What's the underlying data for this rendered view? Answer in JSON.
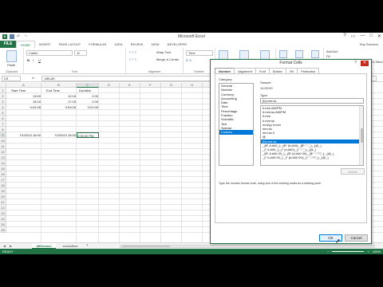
{
  "window": {
    "title": "Microsoft Excel",
    "ctrls": [
      "?",
      "▭",
      "—",
      "□",
      "✕"
    ]
  },
  "ribbon": {
    "file_tab": "FILE",
    "tabs": [
      "HOME",
      "INSERT",
      "PAGE LAYOUT",
      "FORMULAS",
      "DATA",
      "REVIEW",
      "VIEW",
      "DEVELOPER"
    ],
    "active_tab": "HOME",
    "user": "Ray Romano",
    "font_name": "Calibri",
    "font_size": "11",
    "wrap_text": "Wrap Text",
    "merge_center": "Merge & Center",
    "number_format": "Time",
    "paste_label": "Paste",
    "bold": "B",
    "italic": "I",
    "underline": "U",
    "cond_format": "Conditional Formatting",
    "format_table": "Format as Table",
    "cell_styles": "Cell Styles",
    "insert": "Insert",
    "delete": "Delete",
    "format": "Format",
    "autosum": "AutoSum",
    "fill": "Fill",
    "clear": "Clear",
    "sort_filter": "Sort & Filter",
    "find_select": "Find & Select",
    "groups": {
      "clipboard": "Clipboard",
      "font": "Font",
      "alignment": "Alignment",
      "number": "Number",
      "styles": "Styles",
      "cells": "Cells",
      "editing": "Editing"
    }
  },
  "formula_bar": {
    "name_box": "C9",
    "fx": "fx",
    "formula": "=B9-A9"
  },
  "grid": {
    "columns": [
      "A",
      "B",
      "C",
      "D",
      "E",
      "F",
      "G",
      "H",
      "I",
      "J",
      "K",
      "L",
      "M",
      "N",
      "O"
    ],
    "rows": [
      "1",
      "2",
      "3",
      "4",
      "5",
      "6",
      "7",
      "8",
      "9",
      "10",
      "11",
      "12",
      "13",
      "14",
      "15",
      "16",
      "17",
      "18",
      "19",
      "20",
      "21",
      "22",
      "23",
      "24",
      "25",
      "26"
    ],
    "cells": {
      "A1": "Start Time",
      "B1": "End Time",
      "C1": "Duration",
      "A2": "13:00",
      "B2": "12:18",
      "C2": "2.00",
      "A3": "15:15",
      "B3": "17:15",
      "C3": "2.00",
      "A4": "0:02:28",
      "B4": "0:03:26",
      "C4": "0:01:00",
      "A9": "7/1/2013 16:00",
      "B9": "7/2/2013 16:00",
      "C9": "2:00:00 PM"
    }
  },
  "sheets": {
    "tabs": [
      "difference",
      "cumulative"
    ],
    "active": "difference",
    "add": "+"
  },
  "status": {
    "left": "READY",
    "zoom": "100%"
  },
  "dialog": {
    "title": "Format Cells",
    "help": "?",
    "close": "✕",
    "tabs": [
      "Number",
      "Alignment",
      "Font",
      "Border",
      "Fill",
      "Protection"
    ],
    "active_tab": "Number",
    "category_label": "Category:",
    "categories": [
      "General",
      "Number",
      "Currency",
      "Accounting",
      "Date",
      "Time",
      "Percentage",
      "Fraction",
      "Scientific",
      "Text",
      "Special",
      "Custom"
    ],
    "selected_category": "Custom",
    "sample_label": "Sample",
    "sample_value": "14:00:00",
    "type_label": "Type:",
    "type_value": "[h]:mm:ss",
    "types": [
      "h:mm AM/PM",
      "h:mm:ss AM/PM",
      "h:mm",
      "h:mm:ss",
      "m/d/yy h:mm",
      "mm:ss",
      "mm:ss.0",
      "@",
      "[h]:mm:ss",
      "_($* #,##0_);_($* (#,##0);_($* \"-\"_);_(@_)",
      "_(* #,##0_);_(* (#,##0);_(* \"-\"_);_(@_)",
      "_($* #,##0.00_);_($* (#,##0.00);_($* \"-\"??_);_(@_)",
      "_(* #,##0.00_);_(* (#,##0.00);_(* \"-\"??_);_(@_)"
    ],
    "selected_type": "[h]:mm:ss",
    "delete_btn": "Delete",
    "description": "Type the number format code, using one of the existing codes as a starting point.",
    "ok": "OK",
    "cancel": "Cancel"
  }
}
